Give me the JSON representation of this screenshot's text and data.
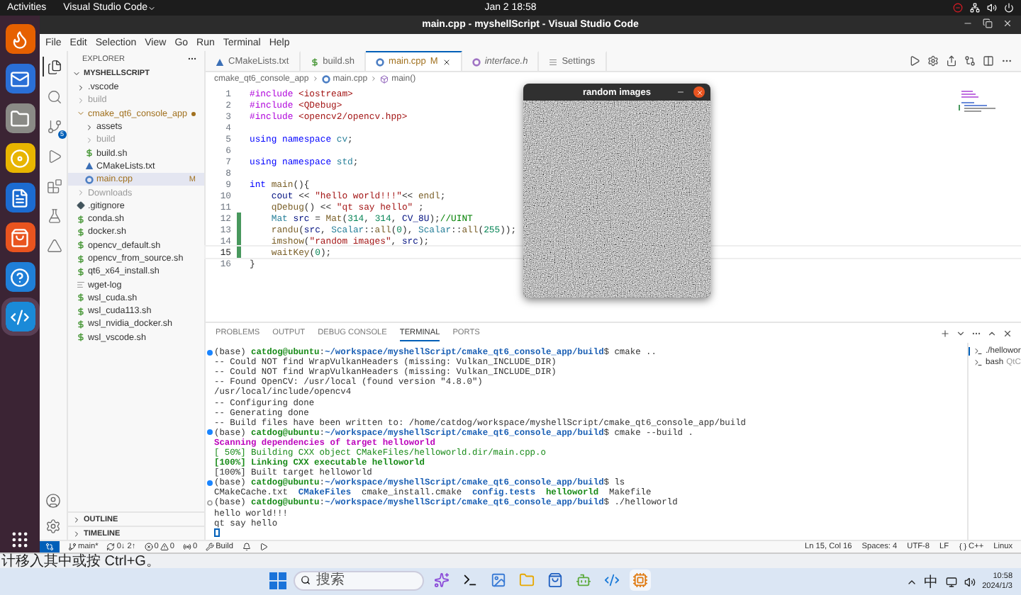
{
  "top_bar": {
    "activities": "Activities",
    "app_name": "Visual Studio Code",
    "clock": "Jan 2  18:58"
  },
  "dock": [
    {
      "kind": "browser",
      "active": false
    },
    {
      "kind": "mail",
      "active": false
    },
    {
      "kind": "files",
      "active": false
    },
    {
      "kind": "music",
      "active": false
    },
    {
      "kind": "writer",
      "active": false
    },
    {
      "kind": "store",
      "active": false
    },
    {
      "kind": "help",
      "active": false
    },
    {
      "kind": "code",
      "active": true
    }
  ],
  "window": {
    "title": "main.cpp - myshellScript - Visual Studio Code"
  },
  "menu": [
    "File",
    "Edit",
    "Selection",
    "View",
    "Go",
    "Run",
    "Terminal",
    "Help"
  ],
  "activity_bar": [
    {
      "kind": "explorer",
      "selected": true
    },
    {
      "kind": "search",
      "selected": false
    },
    {
      "kind": "scm",
      "selected": false,
      "badge": "5"
    },
    {
      "kind": "run",
      "selected": false
    },
    {
      "kind": "extensions",
      "selected": false
    },
    {
      "kind": "testing",
      "selected": false
    },
    {
      "kind": "cmake",
      "selected": false
    }
  ],
  "sidebar": {
    "title": "EXPLORER",
    "root": "MYSHELLSCRIPT",
    "sections": [
      "OUTLINE",
      "TIMELINE"
    ],
    "items": [
      {
        "name": ".vscode",
        "kind": "folder",
        "expanded": false,
        "selected": false,
        "ignored": false,
        "modified": false
      },
      {
        "name": "build",
        "kind": "folder",
        "expanded": false,
        "selected": false,
        "ignored": true,
        "modified": false
      },
      {
        "name": "cmake_qt6_console_app",
        "kind": "folder",
        "expanded": true,
        "selected": false,
        "ignored": false,
        "modified": true,
        "children": [
          {
            "name": "assets",
            "kind": "folder",
            "expanded": false,
            "selected": false,
            "ignored": false,
            "modified": false
          },
          {
            "name": "build",
            "kind": "folder",
            "expanded": false,
            "selected": false,
            "ignored": true,
            "modified": false
          },
          {
            "name": "build.sh",
            "kind": "shell",
            "selected": false,
            "ignored": false,
            "modified": false
          },
          {
            "name": "CMakeLists.txt",
            "kind": "cmake",
            "selected": false,
            "ignored": false,
            "modified": false
          },
          {
            "name": "main.cpp",
            "kind": "cpp",
            "selected": true,
            "ignored": false,
            "modified": true,
            "badge": "M"
          }
        ]
      },
      {
        "name": "Downloads",
        "kind": "folder",
        "expanded": false,
        "selected": false,
        "ignored": true,
        "modified": false
      },
      {
        "name": ".gitignore",
        "kind": "git",
        "selected": false,
        "ignored": false,
        "modified": false
      },
      {
        "name": "conda.sh",
        "kind": "shell",
        "selected": false,
        "ignored": false,
        "modified": false
      },
      {
        "name": "docker.sh",
        "kind": "shell",
        "selected": false,
        "ignored": false,
        "modified": false
      },
      {
        "name": "opencv_default.sh",
        "kind": "shell",
        "selected": false,
        "ignored": false,
        "modified": false
      },
      {
        "name": "opencv_from_source.sh",
        "kind": "shell",
        "selected": false,
        "ignored": false,
        "modified": false
      },
      {
        "name": "qt6_x64_install.sh",
        "kind": "shell",
        "selected": false,
        "ignored": false,
        "modified": false
      },
      {
        "name": "wget-log",
        "kind": "text",
        "selected": false,
        "ignored": false,
        "modified": false
      },
      {
        "name": "wsl_cuda.sh",
        "kind": "shell",
        "selected": false,
        "ignored": false,
        "modified": false
      },
      {
        "name": "wsl_cuda113.sh",
        "kind": "shell",
        "selected": false,
        "ignored": false,
        "modified": false
      },
      {
        "name": "wsl_nvidia_docker.sh",
        "kind": "shell",
        "selected": false,
        "ignored": false,
        "modified": false
      },
      {
        "name": "wsl_vscode.sh",
        "kind": "shell",
        "selected": false,
        "ignored": false,
        "modified": false
      }
    ]
  },
  "tabs": [
    {
      "label": "CMakeLists.txt",
      "kind": "cmake",
      "selected": false,
      "preview": false
    },
    {
      "label": "build.sh",
      "kind": "shell",
      "selected": false,
      "preview": false
    },
    {
      "label": "main.cpp",
      "kind": "cpp",
      "selected": true,
      "preview": false,
      "badge": "M"
    },
    {
      "label": "interface.h",
      "kind": "header",
      "selected": false,
      "preview": true
    },
    {
      "label": "Settings",
      "kind": "settings",
      "selected": false,
      "preview": false
    }
  ],
  "breadcrumbs": [
    {
      "label": "cmake_qt6_console_app",
      "kind": "folder"
    },
    {
      "label": "main.cpp",
      "kind": "cpp"
    },
    {
      "label": "main()",
      "kind": "function"
    }
  ],
  "code": [
    {
      "n": "1",
      "changed": false,
      "current": false,
      "tokens": [
        {
          "kind": "pp",
          "text": "#include "
        },
        {
          "kind": "str",
          "text": "<iostream>"
        }
      ]
    },
    {
      "n": "2",
      "changed": false,
      "current": false,
      "tokens": [
        {
          "kind": "pp",
          "text": "#include "
        },
        {
          "kind": "str",
          "text": "<QDebug>"
        }
      ]
    },
    {
      "n": "3",
      "changed": false,
      "current": false,
      "tokens": [
        {
          "kind": "pp",
          "text": "#include "
        },
        {
          "kind": "str",
          "text": "<opencv2/opencv.hpp>"
        }
      ]
    },
    {
      "n": "4",
      "changed": false,
      "current": false
    },
    {
      "n": "5",
      "changed": false,
      "current": false,
      "tokens": [
        {
          "kind": "kw",
          "text": "using namespace "
        },
        {
          "kind": "type",
          "text": "cv"
        },
        {
          "kind": "plain",
          "text": ";"
        }
      ]
    },
    {
      "n": "6",
      "changed": false,
      "current": false
    },
    {
      "n": "7",
      "changed": false,
      "current": false,
      "tokens": [
        {
          "kind": "kw",
          "text": "using namespace "
        },
        {
          "kind": "type",
          "text": "std"
        },
        {
          "kind": "plain",
          "text": ";"
        }
      ]
    },
    {
      "n": "8",
      "changed": false,
      "current": false
    },
    {
      "n": "9",
      "changed": false,
      "current": false,
      "tokens": [
        {
          "kind": "kw",
          "text": "int "
        },
        {
          "kind": "fn",
          "text": "main"
        },
        {
          "kind": "plain",
          "text": "(){"
        }
      ],
      "children": [
        {
          "n": "10",
          "changed": false,
          "current": false,
          "tokens": [
            {
              "kind": "var",
              "text": "cout"
            },
            {
              "kind": "plain",
              "text": " << "
            },
            {
              "kind": "str",
              "text": "\"hello world!!!\""
            },
            {
              "kind": "plain",
              "text": "<< "
            },
            {
              "kind": "fn",
              "text": "endl"
            },
            {
              "kind": "plain",
              "text": ";"
            }
          ]
        },
        {
          "n": "11",
          "changed": false,
          "current": false,
          "tokens": [
            {
              "kind": "fn",
              "text": "qDebug"
            },
            {
              "kind": "plain",
              "text": "() << "
            },
            {
              "kind": "str",
              "text": "\"qt say hello\""
            },
            {
              "kind": "plain",
              "text": " ;"
            }
          ]
        },
        {
          "n": "12",
          "changed": true,
          "current": false,
          "tokens": [
            {
              "kind": "type",
              "text": "Mat"
            },
            {
              "kind": "var",
              "text": " src"
            },
            {
              "kind": "plain",
              "text": " = "
            },
            {
              "kind": "fn",
              "text": "Mat"
            },
            {
              "kind": "plain",
              "text": "("
            },
            {
              "kind": "num",
              "text": "314"
            },
            {
              "kind": "plain",
              "text": ", "
            },
            {
              "kind": "num",
              "text": "314"
            },
            {
              "kind": "plain",
              "text": ", "
            },
            {
              "kind": "var",
              "text": "CV_8U"
            },
            {
              "kind": "plain",
              "text": ");"
            },
            {
              "kind": "comment",
              "text": "//UINT"
            }
          ]
        },
        {
          "n": "13",
          "changed": true,
          "current": false,
          "tokens": [
            {
              "kind": "fn",
              "text": "randu"
            },
            {
              "kind": "plain",
              "text": "("
            },
            {
              "kind": "var",
              "text": "src"
            },
            {
              "kind": "plain",
              "text": ", "
            },
            {
              "kind": "type",
              "text": "Scalar"
            },
            {
              "kind": "plain",
              "text": "::"
            },
            {
              "kind": "fn",
              "text": "all"
            },
            {
              "kind": "plain",
              "text": "("
            },
            {
              "kind": "num",
              "text": "0"
            },
            {
              "kind": "plain",
              "text": "), "
            },
            {
              "kind": "type",
              "text": "Scalar"
            },
            {
              "kind": "plain",
              "text": "::"
            },
            {
              "kind": "fn",
              "text": "all"
            },
            {
              "kind": "plain",
              "text": "("
            },
            {
              "kind": "num",
              "text": "255"
            },
            {
              "kind": "plain",
              "text": "));"
            }
          ]
        },
        {
          "n": "14",
          "changed": true,
          "current": false,
          "tokens": [
            {
              "kind": "fn",
              "text": "imshow"
            },
            {
              "kind": "plain",
              "text": "("
            },
            {
              "kind": "str",
              "text": "\"random images\""
            },
            {
              "kind": "plain",
              "text": ", "
            },
            {
              "kind": "var",
              "text": "src"
            },
            {
              "kind": "plain",
              "text": ");"
            }
          ]
        },
        {
          "n": "15",
          "changed": true,
          "current": true,
          "tokens": [
            {
              "kind": "fn",
              "text": "waitKey"
            },
            {
              "kind": "plain",
              "text": "("
            },
            {
              "kind": "num",
              "text": "0"
            },
            {
              "kind": "plain",
              "text": ");"
            }
          ]
        }
      ]
    },
    {
      "n": "16",
      "changed": false,
      "current": false,
      "tokens": [
        {
          "kind": "plain",
          "text": "}"
        }
      ]
    }
  ],
  "image_window": {
    "title": "random images"
  },
  "panel": {
    "tabs": [
      {
        "label": "PROBLEMS",
        "selected": false
      },
      {
        "label": "OUTPUT",
        "selected": false
      },
      {
        "label": "DEBUG CONSOLE",
        "selected": false
      },
      {
        "label": "TERMINAL",
        "selected": true
      },
      {
        "label": "PORTS",
        "selected": false
      }
    ],
    "terminal": [
      {
        "kind": "done",
        "spans": [
          {
            "kind": "plain",
            "text": "(base) "
          },
          {
            "kind": "user",
            "text": "catdog@ubuntu"
          },
          {
            "kind": "plain",
            "text": ":"
          },
          {
            "kind": "path",
            "text": "~/workspace/myshellScript/cmake_qt6_console_app/build"
          },
          {
            "kind": "plain",
            "text": "$ cmake .."
          }
        ]
      },
      {
        "kind": "output",
        "spans": [
          {
            "kind": "plain",
            "text": "-- Could NOT find WrapVulkanHeaders (missing: Vulkan_INCLUDE_DIR)"
          }
        ]
      },
      {
        "kind": "output",
        "spans": [
          {
            "kind": "plain",
            "text": "-- Could NOT find WrapVulkanHeaders (missing: Vulkan_INCLUDE_DIR)"
          }
        ]
      },
      {
        "kind": "output",
        "spans": [
          {
            "kind": "plain",
            "text": "-- Found OpenCV: /usr/local (found version \"4.8.0\")"
          }
        ]
      },
      {
        "kind": "output",
        "spans": [
          {
            "kind": "plain",
            "text": "/usr/local/include/opencv4"
          }
        ]
      },
      {
        "kind": "output",
        "spans": [
          {
            "kind": "plain",
            "text": "-- Configuring done"
          }
        ]
      },
      {
        "kind": "output",
        "spans": [
          {
            "kind": "plain",
            "text": "-- Generating done"
          }
        ]
      },
      {
        "kind": "output",
        "spans": [
          {
            "kind": "plain",
            "text": "-- Build files have been written to: /home/catdog/workspace/myshellScript/cmake_qt6_console_app/build"
          }
        ]
      },
      {
        "kind": "done",
        "spans": [
          {
            "kind": "plain",
            "text": "(base) "
          },
          {
            "kind": "user",
            "text": "catdog@ubuntu"
          },
          {
            "kind": "plain",
            "text": ":"
          },
          {
            "kind": "path",
            "text": "~/workspace/myshellScript/cmake_qt6_console_app/build"
          },
          {
            "kind": "plain",
            "text": "$ cmake --build ."
          }
        ]
      },
      {
        "kind": "output",
        "spans": [
          {
            "kind": "magenta",
            "text": "Scanning dependencies of target helloworld"
          }
        ]
      },
      {
        "kind": "output",
        "spans": [
          {
            "kind": "green",
            "text": "[ 50%] Building CXX object CMakeFiles/helloworld.dir/main.cpp.o"
          }
        ]
      },
      {
        "kind": "output",
        "spans": [
          {
            "kind": "user",
            "text": "[100%] Linking CXX executable helloworld"
          }
        ]
      },
      {
        "kind": "output",
        "spans": [
          {
            "kind": "plain",
            "text": "[100%] Built target helloworld"
          }
        ]
      },
      {
        "kind": "done",
        "spans": [
          {
            "kind": "plain",
            "text": "(base) "
          },
          {
            "kind": "user",
            "text": "catdog@ubuntu"
          },
          {
            "kind": "plain",
            "text": ":"
          },
          {
            "kind": "path",
            "text": "~/workspace/myshellScript/cmake_qt6_console_app/build"
          },
          {
            "kind": "plain",
            "text": "$ ls"
          }
        ]
      },
      {
        "kind": "output",
        "spans": [
          {
            "kind": "plain",
            "text": "CMakeCache.txt  "
          },
          {
            "kind": "path",
            "text": "CMakeFiles"
          },
          {
            "kind": "plain",
            "text": "  cmake_install.cmake  "
          },
          {
            "kind": "path",
            "text": "config.tests  "
          },
          {
            "kind": "user",
            "text": "helloworld"
          },
          {
            "kind": "plain",
            "text": "  Makefile"
          }
        ]
      },
      {
        "kind": "pending",
        "spans": [
          {
            "kind": "plain",
            "text": "(base) "
          },
          {
            "kind": "user",
            "text": "catdog@ubuntu"
          },
          {
            "kind": "plain",
            "text": ":"
          },
          {
            "kind": "path",
            "text": "~/workspace/myshellScript/cmake_qt6_console_app/build"
          },
          {
            "kind": "plain",
            "text": "$ ./helloworld"
          }
        ]
      },
      {
        "kind": "output",
        "spans": [
          {
            "kind": "plain",
            "text": "hello world!!!"
          }
        ]
      },
      {
        "kind": "output",
        "spans": [
          {
            "kind": "plain",
            "text": "qt say hello"
          }
        ]
      }
    ],
    "sessions": [
      {
        "name": "./hellowor",
        "selected": true
      },
      {
        "name": "bash",
        "detail": "QtC",
        "selected": false
      }
    ]
  },
  "status_bar": {
    "branch": "main*",
    "sync": "0↓ 2↑",
    "errors": "0",
    "warnings": "0",
    "ports": "0",
    "build": "Build",
    "position": "Ln 15, Col 16",
    "indent": "Spaces: 4",
    "encoding": "UTF-8",
    "eol": "LF",
    "language": "C++",
    "platform": "Linux"
  },
  "windows_hint": "计移入其中或按 Ctrl+G。",
  "taskbar": {
    "search": {
      "placeholder": "搜索"
    },
    "apps": [
      {
        "kind": "copilot",
        "active": false
      },
      {
        "kind": "terminal",
        "active": false
      },
      {
        "kind": "photos",
        "active": false
      },
      {
        "kind": "explorer",
        "active": false
      },
      {
        "kind": "store",
        "active": false
      },
      {
        "kind": "android",
        "active": false
      },
      {
        "kind": "code",
        "active": false
      },
      {
        "kind": "vm",
        "active": true
      }
    ],
    "ime": "中",
    "time": "10:58",
    "date": "2024/1/3"
  }
}
